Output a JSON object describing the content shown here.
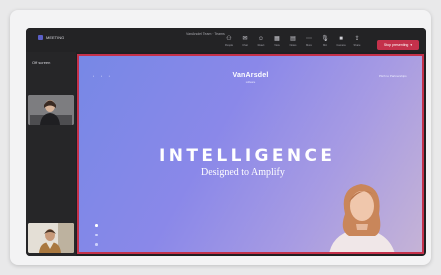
{
  "app": {
    "name": "MEETING",
    "window_title": "VanArsdel Team · Teams"
  },
  "toolbar": [
    {
      "icon": "people-icon",
      "label": "People"
    },
    {
      "icon": "chat-icon",
      "label": "Chat"
    },
    {
      "icon": "react-icon",
      "label": "React"
    },
    {
      "icon": "view-icon",
      "label": "View"
    },
    {
      "icon": "notes-icon",
      "label": "Notes"
    },
    {
      "icon": "more-icon",
      "label": "More"
    },
    {
      "icon": "mic-icon",
      "label": "Mic"
    },
    {
      "icon": "camera-icon",
      "label": "Camera"
    },
    {
      "icon": "share-icon",
      "label": "Share"
    }
  ],
  "share_button": {
    "label": "Stop presenting"
  },
  "sidebar": {
    "label": "Off screen"
  },
  "slide": {
    "logo": "VanArsdel",
    "logo_sub": "software",
    "corner_text": "Pitch to Partnerships",
    "corner_dots": "• • •",
    "headline": "INTELLIGENCE",
    "subhead": "Designed to Amplify"
  },
  "colors": {
    "accent": "#c4314b",
    "brand": "#5b5fc7"
  }
}
